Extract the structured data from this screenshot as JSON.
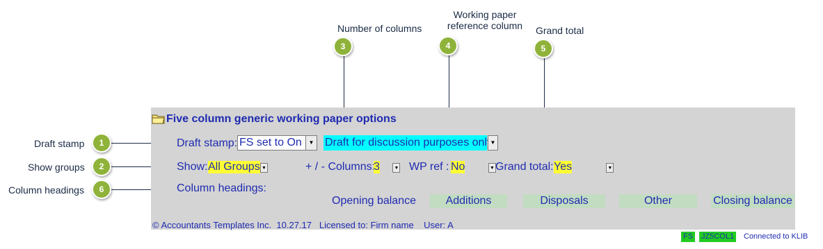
{
  "callouts": {
    "number_of_columns": "Number of columns",
    "working_paper_ref_line1": "Working paper",
    "working_paper_ref_line2": "reference column",
    "grand_total": "Grand total",
    "draft_stamp": "Draft stamp",
    "show_groups": "Show groups",
    "column_headings": "Column headings"
  },
  "badges": {
    "b1": "1",
    "b2": "2",
    "b3": "3",
    "b4": "4",
    "b5": "5",
    "b6": "6"
  },
  "panel": {
    "title": "Five column generic working paper options",
    "draft_stamp_label": "Draft stamp:",
    "draft_stamp_value": "FS set to On",
    "draft_text_value": "Draft for discussion purposes only",
    "show_label": "Show:",
    "show_value": "All Groups",
    "columns_label": "+ / - Columns:",
    "columns_value": "3",
    "wp_ref_label": "WP ref :",
    "wp_ref_value": "No",
    "grand_total_label": "Grand total:",
    "grand_total_value": "Yes",
    "column_headings_label": "Column headings:",
    "columns": [
      "Opening balance",
      "Additions",
      "Disposals",
      "Other",
      "Closing balance"
    ],
    "footer": "© Accountants Templates Inc.  10.27.17   Licensed to: Firm name    User: A"
  },
  "status_bar": {
    "fs": "FS",
    "code": "JZ5COL1",
    "connection": "Connected to KLIB"
  },
  "colors": {
    "badge": "#8fb33a",
    "panel_bg": "#d4d4d4",
    "text_blue": "#1f2bb0",
    "highlight_yellow": "#ffff33",
    "highlight_cyan": "#00ffff",
    "column_bg": "#c2dcc2",
    "status_green": "#22cc22"
  },
  "icons": {
    "folder": "folder-icon",
    "dropdown": "chevron-down-icon"
  }
}
